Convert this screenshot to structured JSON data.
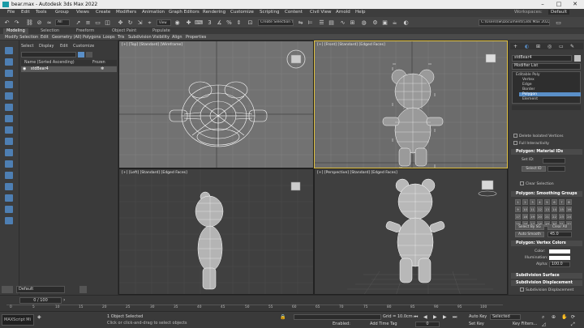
{
  "window": {
    "title": "bear.max - Autodesk 3ds Max 2022",
    "minimize": "–",
    "maximize": "□",
    "close": "✕"
  },
  "menu": [
    "File",
    "Edit",
    "Tools",
    "Group",
    "Views",
    "Create",
    "Modifiers",
    "Animation",
    "Graph Editors",
    "Rendering",
    "Customize",
    "Scripting",
    "Content",
    "Civil View",
    "Arnold",
    "Help"
  ],
  "workspace": {
    "label": "Workspaces:",
    "value": "Default"
  },
  "toolbar": {
    "selection_set": "Create Selection Set",
    "selection_filter": "All",
    "path": "C:\\Users\\Iw\\Documents\\3ds Max 2022"
  },
  "ribbon": {
    "tabs": [
      "Modeling",
      "Selection",
      "Freeform",
      "Object Paint",
      "Populate"
    ],
    "items": [
      "Modify Selection",
      "Edit",
      "Geometry (All)",
      "Polygons",
      "Loops",
      "Tris",
      "Subdivision",
      "Visibility",
      "Align",
      "Properties"
    ]
  },
  "scene_explorer": {
    "tabs": [
      "Select",
      "Display",
      "Edit",
      "Customize"
    ],
    "col_name": "Name (Sorted Ascending)",
    "col_frozen": "Frozen",
    "object": "stdBear4"
  },
  "viewports": {
    "top": "[+] [Top] [Standard] [Wireframe]",
    "front": "[+] [Front] [Standard] [Edged Faces]",
    "left": "[+] [Left] [Standard] [Edged Faces]",
    "perspective": "[+] [Perspective] [Standard] [Edged Faces]"
  },
  "command_panel": {
    "object_name": "stdBear4",
    "modifier_list": "Modifier List",
    "stack": [
      "Editable Poly",
      "Vertex",
      "Edge",
      "Border",
      "Polygon",
      "Element"
    ],
    "delete_isolated": "Delete Isolated Vertices",
    "full_interactivity": "Full Interactivity",
    "material_ids_title": "Polygon: Material IDs",
    "set_id": "Set ID:",
    "select_id": "Select ID",
    "clear_selection": "Clear Selection",
    "smoothing_title": "Polygon: Smoothing Groups",
    "smoothing_groups": [
      "1",
      "2",
      "3",
      "4",
      "5",
      "6",
      "7",
      "8",
      "9",
      "10",
      "11",
      "12",
      "13",
      "14",
      "15",
      "16",
      "17",
      "18",
      "19",
      "20",
      "21",
      "22",
      "23",
      "24",
      "25",
      "26",
      "27",
      "28",
      "29",
      "30",
      "31",
      "32"
    ],
    "select_by_sg": "Select By SG",
    "clear_all": "Clear All",
    "auto_smooth": "Auto Smooth",
    "auto_smooth_value": "45.0",
    "vertex_colors_title": "Polygon: Vertex Colors",
    "color_label": "Color:",
    "illumination_label": "Illumination:",
    "alpha_label": "Alpha:",
    "alpha_value": "100.0",
    "subdivision_surface": "Subdivision Surface",
    "subdivision_displacement": "Subdivision Displacement",
    "subdivision_displacement_check": "Subdivision Displacement"
  },
  "timeline": {
    "layer": "Default",
    "frame": "0 / 100",
    "ticks": [
      "0",
      "5",
      "10",
      "15",
      "20",
      "25",
      "30",
      "35",
      "40",
      "45",
      "50",
      "55",
      "60",
      "65",
      "70",
      "75",
      "80",
      "85",
      "90",
      "95",
      "100"
    ]
  },
  "status": {
    "script": "MAXScript Mi",
    "selected": "1 Object Selected",
    "hint": "Click or click-and-drag to select objects",
    "grid": "Grid = 10.0cm",
    "enabled": "Enabled:",
    "add_time_tag": "Add Time Tag",
    "auto_key": "Auto Key",
    "set_key": "Set Key",
    "selected_dropdown": "Selected",
    "key_filters": "Key Filters...",
    "frame_value": "0"
  },
  "colors": {
    "accent_blue": "#4e7fb3",
    "active_border": "#e0c040",
    "selection": "#5a8fc8"
  }
}
